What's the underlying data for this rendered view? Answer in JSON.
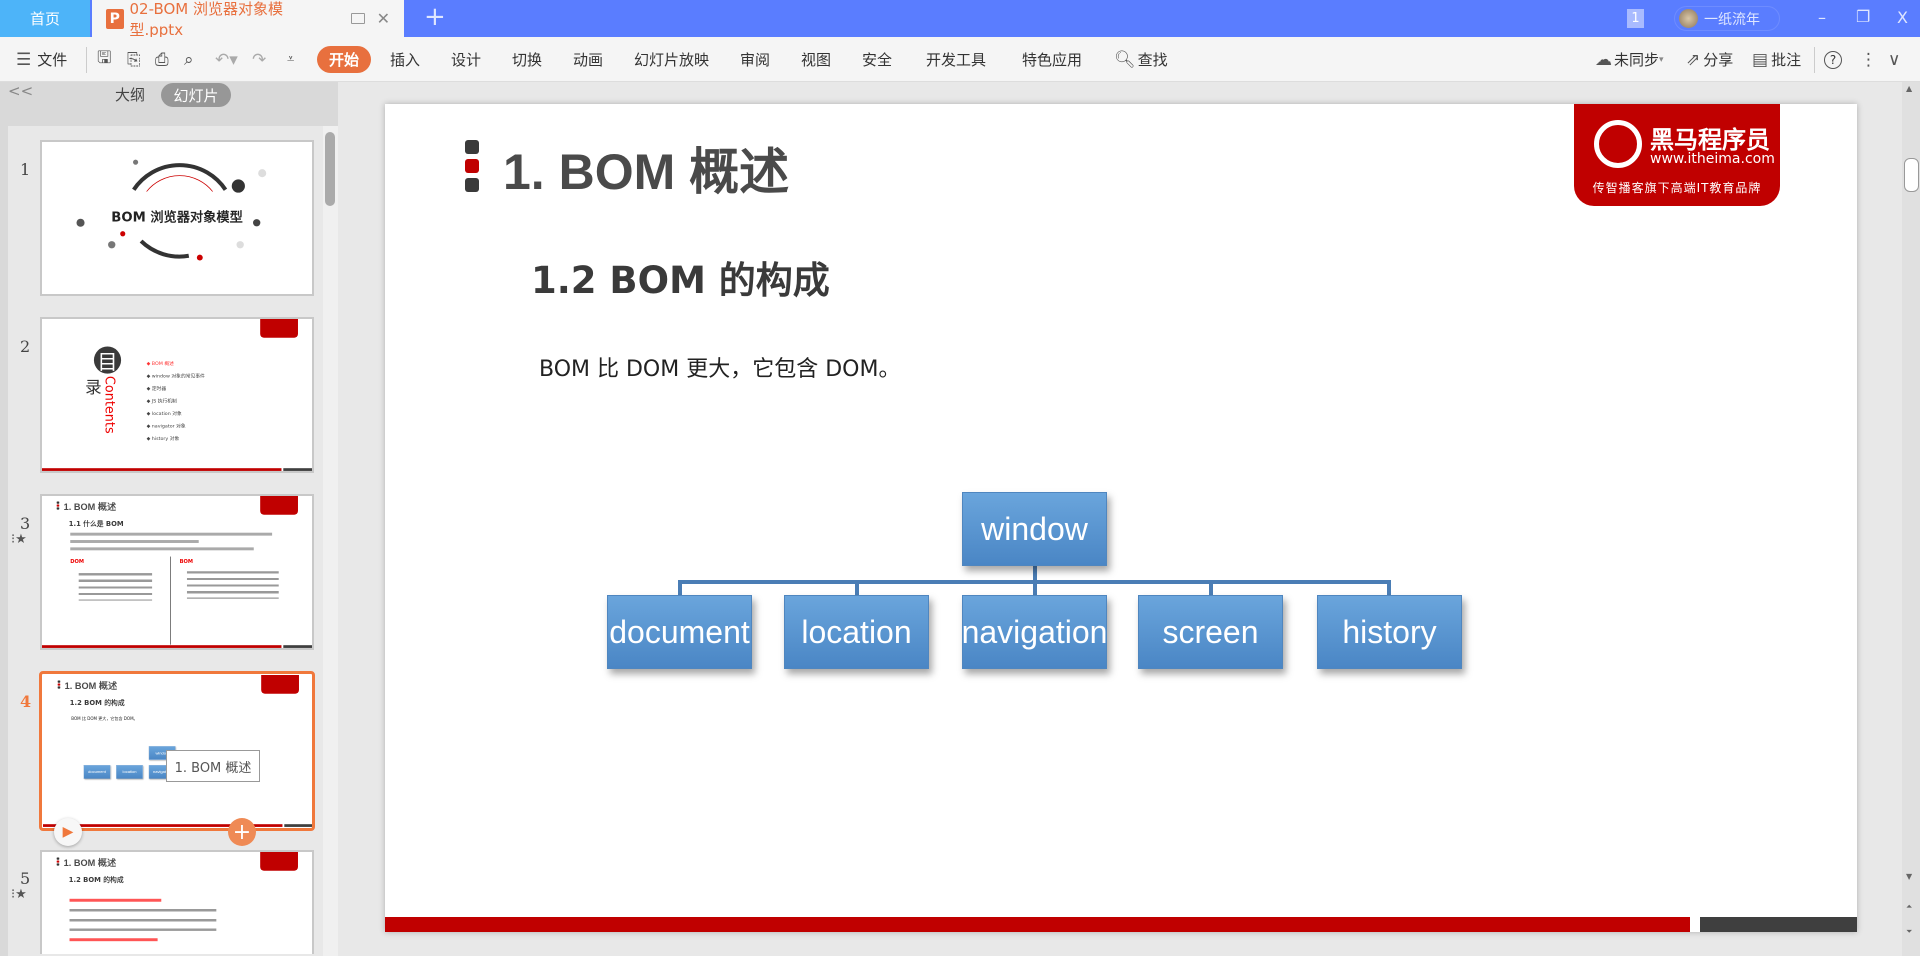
{
  "tabs": {
    "home": "首页",
    "document": "02-BOM 浏览器对象模型.pptx",
    "new_tab": "+"
  },
  "window": {
    "notification_count": "1",
    "user_name": "一纸流年",
    "minimize": "–",
    "restore": "❐",
    "close": "X"
  },
  "toolbar": {
    "file": "文件",
    "menus": [
      "开始",
      "插入",
      "设计",
      "切换",
      "动画",
      "幻灯片放映",
      "审阅",
      "视图",
      "安全",
      "开发工具",
      "特色应用",
      "查找"
    ],
    "sync": "未同步",
    "share": "分享",
    "comment": "批注",
    "help": "?"
  },
  "left_panel": {
    "outline_tab": "大纲",
    "slides_tab": "幻灯片",
    "collapse": "<<"
  },
  "thumbnails": [
    {
      "number": "1",
      "title": "BOM 浏览器对象模型"
    },
    {
      "number": "2",
      "toc_char1": "目",
      "toc_char2": "录",
      "contents": "Contents",
      "items": [
        "BOM 概述",
        "window 对象的常见事件",
        "定时器",
        "JS 执行机制",
        "location 对象",
        "navigator 对象",
        "history 对象"
      ]
    },
    {
      "number": "3",
      "title": "1. BOM 概述",
      "subtitle": "1.1 什么是 BOM",
      "col1": "DOM",
      "col2": "BOM"
    },
    {
      "number": "4",
      "title": "1. BOM 概述",
      "subtitle": "1.2 BOM 的构成",
      "text": "BOM 比 DOM 更大，它包含 DOM。",
      "tooltip": "1. BOM 概述"
    },
    {
      "number": "5",
      "title": "1. BOM 概述",
      "subtitle": "1.2 BOM 的构成"
    }
  ],
  "slide": {
    "title": "1. BOM 概述",
    "subtitle": "1.2 BOM 的构成",
    "text": "BOM 比 DOM 更大，它包含 DOM。",
    "logo": {
      "name": "黑马程序员",
      "url": "www.itheima.com",
      "slogan": "传智播客旗下高端IT教育品牌"
    },
    "diagram": {
      "root": "window",
      "children": [
        "document",
        "location",
        "navigation",
        "screen",
        "history"
      ]
    }
  },
  "colors": {
    "accent": "#e8703e",
    "tabbar": "#5a7dff",
    "brand_red": "#c00000",
    "box_blue": "#5b9bd5"
  }
}
